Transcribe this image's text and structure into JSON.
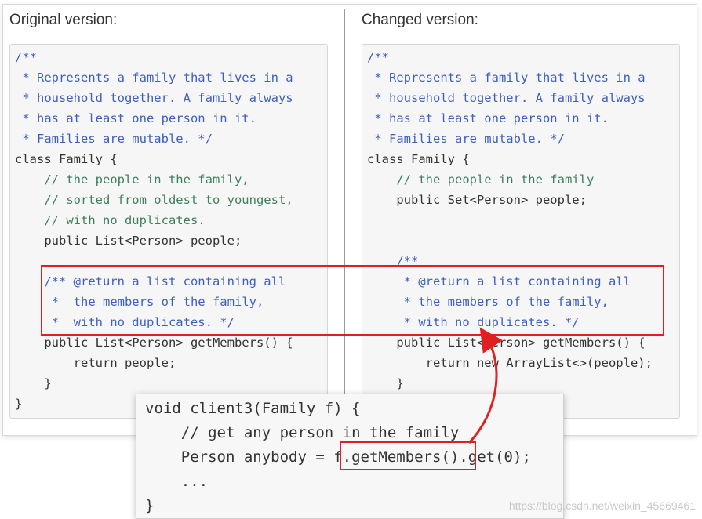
{
  "left": {
    "title": "Original version:",
    "lines": [
      "/**",
      " * Represents a family that lives in a",
      " * household together. A family always",
      " * has at least one person in it.",
      " * Families are mutable. */",
      "class Family {",
      "    // the people in the family,",
      "    // sorted from oldest to youngest,",
      "    // with no duplicates.",
      "    public List<Person> people;",
      "",
      "    /** @return a list containing all",
      "     *  the members of the family,",
      "     *  with no duplicates. */",
      "    public List<Person> getMembers() {",
      "        return people;",
      "    }",
      "}"
    ]
  },
  "right": {
    "title": "Changed version:",
    "lines": [
      "/**",
      " * Represents a family that lives in a",
      " * household together. A family always",
      " * has at least one person in it.",
      " * Families are mutable. */",
      "class Family {",
      "    // the people in the family",
      "    public Set<Person> people;",
      "",
      "",
      "    /**",
      "     * @return a list containing all",
      "     * the members of the family,",
      "     * with no duplicates. */",
      "    public List<Person> getMembers() {",
      "        return new ArrayList<>(people);",
      "    }"
    ]
  },
  "popup": {
    "lines": [
      "void client3(Family f) {",
      "    // get any person in the family",
      "    Person anybody = f.getMembers().get(0);",
      "    ...",
      "}"
    ]
  },
  "watermark": "https://blog.csdn.net/weixin_45669461",
  "colors": {
    "highlight": "#e02020",
    "comment": "#3f7f5f",
    "keyword": "#7f0055",
    "javadoc": "#3f5fbf"
  }
}
